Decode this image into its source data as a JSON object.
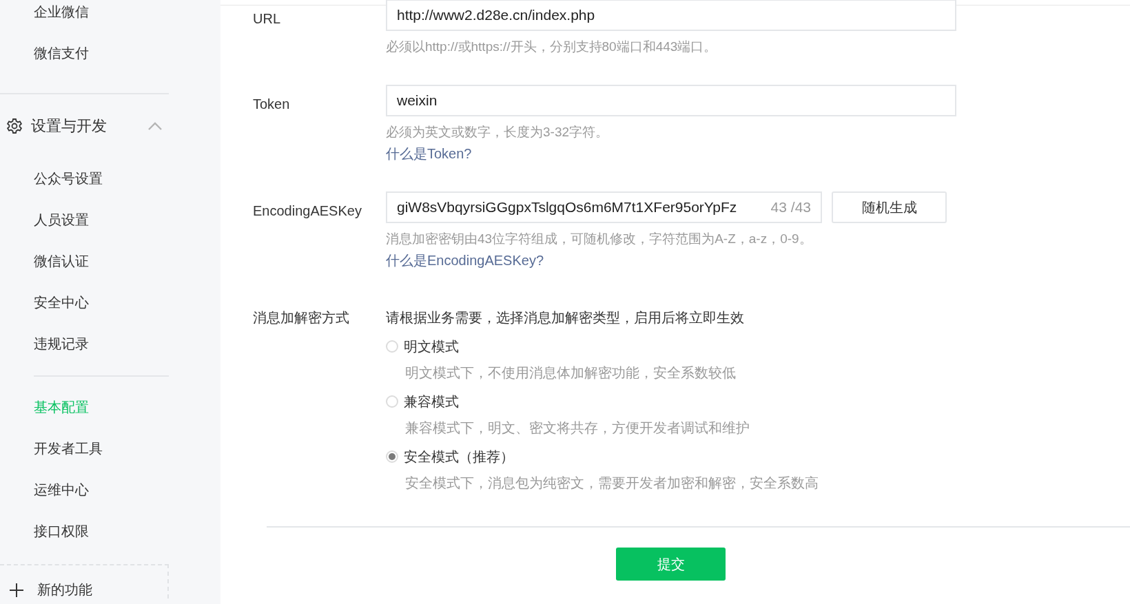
{
  "sidebar": {
    "top_items": [
      {
        "label": "企业微信",
        "selected": false
      },
      {
        "label": "微信支付",
        "selected": false
      }
    ],
    "section": {
      "label": "设置与开发",
      "expanded": true,
      "groups": [
        [
          {
            "label": "公众号设置",
            "selected": false
          },
          {
            "label": "人员设置",
            "selected": false
          },
          {
            "label": "微信认证",
            "selected": false
          },
          {
            "label": "安全中心",
            "selected": false
          },
          {
            "label": "违规记录",
            "selected": false
          }
        ],
        [
          {
            "label": "基本配置",
            "selected": true
          },
          {
            "label": "开发者工具",
            "selected": false
          },
          {
            "label": "运维中心",
            "selected": false
          },
          {
            "label": "接口权限",
            "selected": false
          }
        ]
      ]
    },
    "new_feature": {
      "label": "新的功能"
    }
  },
  "form": {
    "fields": [
      {
        "label": "URL",
        "value": "http://www2.d28e.cn/index.php",
        "hint": "必须以http://或https://开头，分别支持80端口和443端口。"
      },
      {
        "label": "Token",
        "value": "weixin",
        "hint": "必须为英文或数字，长度为3-32字符。",
        "link": "什么是Token?"
      },
      {
        "label": "EncodingAESKey",
        "value": "giW8sVbqyrsiGGgpxTslgqOs6m6M7t1XFer95orYpFz",
        "counter": "43 /43",
        "button": "随机生成",
        "hint": "消息加密密钥由43位字符组成，可随机修改，字符范围为A-Z，a-z，0-9。",
        "link": "什么是EncodingAESKey?"
      }
    ],
    "encryption": {
      "label": "消息加解密方式",
      "prompt": "请根据业务需要，选择消息加解密类型，启用后将立即生效",
      "options": [
        {
          "label": "明文模式",
          "description": "明文模式下，不使用消息体加解密功能，安全系数较低",
          "selected": false
        },
        {
          "label": "兼容模式",
          "description": "兼容模式下，明文、密文将共存，方便开发者调试和维护",
          "selected": false
        },
        {
          "label": "安全模式（推荐）",
          "description": "安全模式下，消息包为纯密文，需要开发者加密和解密，安全系数高",
          "selected": true
        }
      ]
    },
    "submit": "提交"
  }
}
